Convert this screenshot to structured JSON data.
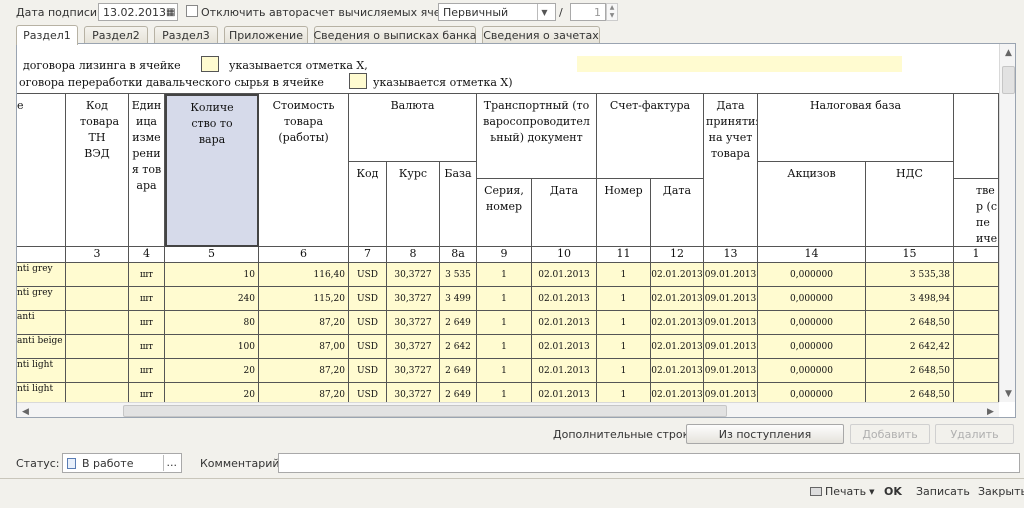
{
  "toolbar": {
    "sign_date_label": "Дата подписи:",
    "sign_date_value": "13.02.2013",
    "auto_calc_label": "Отключить авторасчет вычисляемых ячеек",
    "auto_calc_checked": false,
    "doc_type_value": "Первичный",
    "page_sep": "/",
    "page_total": "1"
  },
  "tabs": [
    "Раздел1",
    "Раздел2",
    "Раздел3",
    "Приложение",
    "Сведения о выписках банка",
    "Сведения о зачетах"
  ],
  "active_tab": 0,
  "sheet": {
    "note_line1a": "договора лизинга в ячейке",
    "note_line1b": "указывается отметка X,",
    "note_line2a": "оговора переработки давальческого сырья в ячейке",
    "note_line2b": "указывается отметка X)",
    "headers": {
      "col_name_frag": "е",
      "col3": "Код товара ТН ВЭД",
      "col4": "Единица измерения товара",
      "col5": "Количество товара",
      "col6": "Стоимость товара (работы)",
      "currency": "Валюта",
      "cur_code": "Код",
      "cur_rate": "Курс",
      "cur_base": "База",
      "transport": "Транспортный (товаросопроводительный) документ",
      "tr_series": "Серия, номер",
      "tr_date": "Дата",
      "invoice": "Счет-фактура",
      "inv_num": "Номер",
      "inv_date": "Дата",
      "accept_date": "Дата принятия на учет товара",
      "tax_base": "Налоговая база",
      "excise": "Акцизов",
      "vat": "НДС",
      "col16_frag": "твер (спе ичес"
    },
    "col_numbers": [
      "3",
      "4",
      "5",
      "6",
      "7",
      "8",
      "8а",
      "9",
      "10",
      "11",
      "12",
      "13",
      "14",
      "15",
      "1"
    ],
    "rows": [
      {
        "name": "nti grey",
        "unit": "шт",
        "qty": "10",
        "cost": "116,40",
        "code": "USD",
        "rate": "30,3727",
        "base": "3 535",
        "series": "1",
        "tr_date": "02.01.2013",
        "inv_num": "1",
        "inv_date": "02.01.2013",
        "accept": "09.01.2013",
        "excise": "0,000000",
        "vat": "3 535,38"
      },
      {
        "name": "nti grey",
        "unit": "шт",
        "qty": "240",
        "cost": "115,20",
        "code": "USD",
        "rate": "30,3727",
        "base": "3 499",
        "series": "1",
        "tr_date": "02.01.2013",
        "inv_num": "1",
        "inv_date": "02.01.2013",
        "accept": "09.01.2013",
        "excise": "0,000000",
        "vat": "3 498,94"
      },
      {
        "name": "anti",
        "unit": "шт",
        "qty": "80",
        "cost": "87,20",
        "code": "USD",
        "rate": "30,3727",
        "base": "2 649",
        "series": "1",
        "tr_date": "02.01.2013",
        "inv_num": "1",
        "inv_date": "02.01.2013",
        "accept": "09.01.2013",
        "excise": "0,000000",
        "vat": "2 648,50"
      },
      {
        "name": "anti beige",
        "unit": "шт",
        "qty": "100",
        "cost": "87,00",
        "code": "USD",
        "rate": "30,3727",
        "base": "2 642",
        "series": "1",
        "tr_date": "02.01.2013",
        "inv_num": "1",
        "inv_date": "02.01.2013",
        "accept": "09.01.2013",
        "excise": "0,000000",
        "vat": "2 642,42"
      },
      {
        "name": "nti light",
        "unit": "шт",
        "qty": "20",
        "cost": "87,20",
        "code": "USD",
        "rate": "30,3727",
        "base": "2 649",
        "series": "1",
        "tr_date": "02.01.2013",
        "inv_num": "1",
        "inv_date": "02.01.2013",
        "accept": "09.01.2013",
        "excise": "0,000000",
        "vat": "2 648,50"
      },
      {
        "name": "nti light",
        "unit": "шт",
        "qty": "20",
        "cost": "87,20",
        "code": "USD",
        "rate": "30,3727",
        "base": "2 649",
        "series": "1",
        "tr_date": "02.01.2013",
        "inv_num": "1",
        "inv_date": "02.01.2013",
        "accept": "09.01.2013",
        "excise": "0,000000",
        "vat": "2 648,50"
      }
    ]
  },
  "extra_rows": {
    "label": "Дополнительные строки:",
    "from_receipt": "Из поступления",
    "add": "Добавить",
    "delete": "Удалить"
  },
  "status": {
    "label": "Статус:",
    "value": "В работе",
    "comment_label": "Комментарий:",
    "comment_value": ""
  },
  "footer": {
    "print": "Печать",
    "ok": "OK",
    "save": "Записать",
    "close": "Закрыть"
  },
  "colors": {
    "cell_yellow": "#fffbd0",
    "selected_header": "#d6daea"
  }
}
